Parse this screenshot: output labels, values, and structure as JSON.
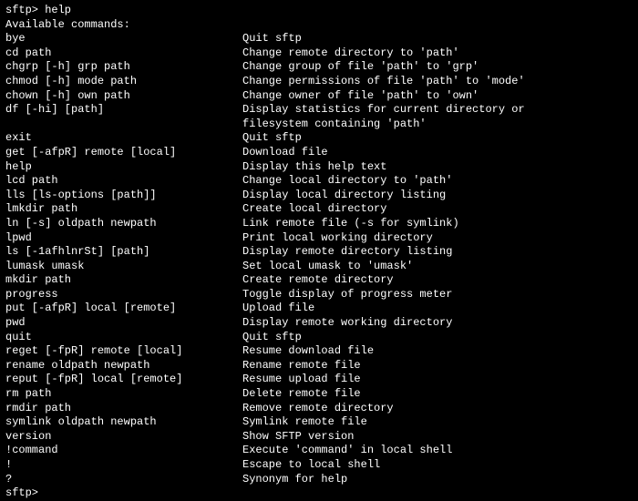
{
  "prompt1": "sftp> help",
  "header": "Available commands:",
  "rows": [
    {
      "cmd": "bye",
      "desc": "Quit sftp"
    },
    {
      "cmd": "cd path",
      "desc": "Change remote directory to 'path'"
    },
    {
      "cmd": "chgrp [-h] grp path",
      "desc": "Change group of file 'path' to 'grp'"
    },
    {
      "cmd": "chmod [-h] mode path",
      "desc": "Change permissions of file 'path' to 'mode'"
    },
    {
      "cmd": "chown [-h] own path",
      "desc": "Change owner of file 'path' to 'own'"
    },
    {
      "cmd": "df [-hi] [path]",
      "desc": "Display statistics for current directory or"
    },
    {
      "cmd": "",
      "desc": "filesystem containing 'path'"
    },
    {
      "cmd": "exit",
      "desc": "Quit sftp"
    },
    {
      "cmd": "get [-afpR] remote [local]",
      "desc": "Download file"
    },
    {
      "cmd": "help",
      "desc": "Display this help text"
    },
    {
      "cmd": "lcd path",
      "desc": "Change local directory to 'path'"
    },
    {
      "cmd": "lls [ls-options [path]]",
      "desc": "Display local directory listing"
    },
    {
      "cmd": "lmkdir path",
      "desc": "Create local directory"
    },
    {
      "cmd": "ln [-s] oldpath newpath",
      "desc": "Link remote file (-s for symlink)"
    },
    {
      "cmd": "lpwd",
      "desc": "Print local working directory"
    },
    {
      "cmd": "ls [-1afhlnrSt] [path]",
      "desc": "Display remote directory listing"
    },
    {
      "cmd": "lumask umask",
      "desc": "Set local umask to 'umask'"
    },
    {
      "cmd": "mkdir path",
      "desc": "Create remote directory"
    },
    {
      "cmd": "progress",
      "desc": "Toggle display of progress meter"
    },
    {
      "cmd": "put [-afpR] local [remote]",
      "desc": "Upload file"
    },
    {
      "cmd": "pwd",
      "desc": "Display remote working directory"
    },
    {
      "cmd": "quit",
      "desc": "Quit sftp"
    },
    {
      "cmd": "reget [-fpR] remote [local]",
      "desc": "Resume download file"
    },
    {
      "cmd": "rename oldpath newpath",
      "desc": "Rename remote file"
    },
    {
      "cmd": "reput [-fpR] local [remote]",
      "desc": "Resume upload file"
    },
    {
      "cmd": "rm path",
      "desc": "Delete remote file"
    },
    {
      "cmd": "rmdir path",
      "desc": "Remove remote directory"
    },
    {
      "cmd": "symlink oldpath newpath",
      "desc": "Symlink remote file"
    },
    {
      "cmd": "version",
      "desc": "Show SFTP version"
    },
    {
      "cmd": "!command",
      "desc": "Execute 'command' in local shell"
    },
    {
      "cmd": "!",
      "desc": "Escape to local shell"
    },
    {
      "cmd": "?",
      "desc": "Synonym for help"
    }
  ],
  "prompt2": "sftp>"
}
